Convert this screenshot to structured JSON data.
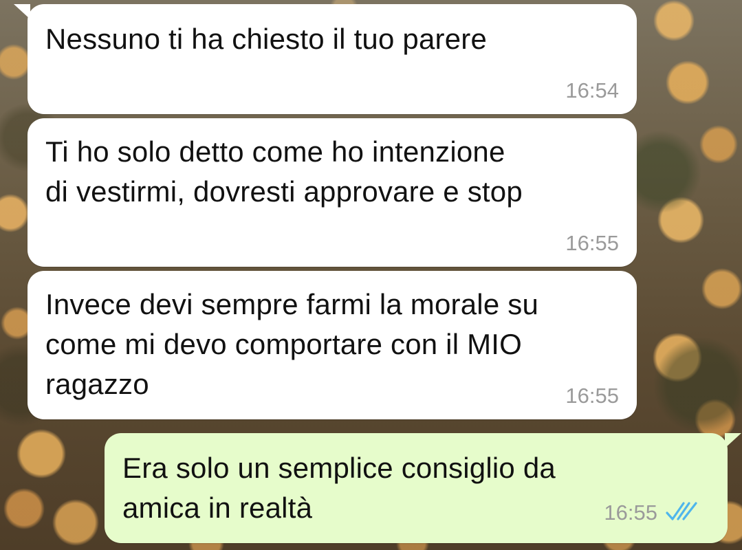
{
  "messages": [
    {
      "direction": "incoming",
      "text": "Nessuno ti ha chiesto il tuo parere",
      "time": "16:54"
    },
    {
      "direction": "incoming",
      "text": "Ti ho solo detto come ho intenzione\ndi vestirmi, dovresti approvare e stop",
      "time": "16:55"
    },
    {
      "direction": "incoming",
      "text": "Invece devi sempre farmi la morale su\ncome mi devo comportare con il MIO\nragazzo",
      "time": "16:55"
    },
    {
      "direction": "outgoing",
      "text": "Era solo un semplice consiglio da\namica in realtà",
      "time": "16:55",
      "status_icon": "double-check-read-icon"
    }
  ],
  "colors": {
    "incoming_bubble": "#ffffff",
    "outgoing_bubble": "#e6fccb",
    "timestamp": "#9a9a9a",
    "read_ticks": "#4fb6ec"
  }
}
